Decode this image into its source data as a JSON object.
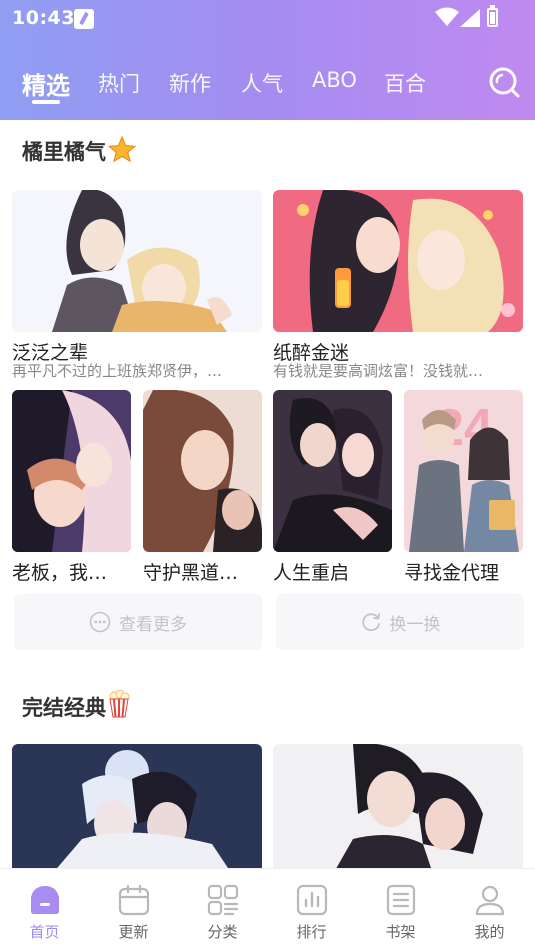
{
  "status_bar": {
    "time": "10:43"
  },
  "tabs": [
    {
      "label": "精选",
      "active": true
    },
    {
      "label": "热门",
      "active": false
    },
    {
      "label": "新作",
      "active": false
    },
    {
      "label": "人气",
      "active": false
    },
    {
      "label": "ABO",
      "active": false
    },
    {
      "label": "百合",
      "active": false
    }
  ],
  "sections": [
    {
      "title": "橘里橘气",
      "emoji": "star-icon",
      "featured": [
        {
          "title": "泛泛之辈",
          "desc": "再平凡不过的上班族郑贤伊，…"
        },
        {
          "title": "纸醉金迷",
          "desc": "有钱就是要高调炫富！没钱就…"
        }
      ],
      "items": [
        {
          "title": "老板，我…"
        },
        {
          "title": "守护黑道…"
        },
        {
          "title": "人生重启"
        },
        {
          "title": "寻找金代理"
        }
      ],
      "more_label": "查看更多",
      "refresh_label": "换一换"
    },
    {
      "title": "完结经典",
      "emoji": "popcorn-icon"
    }
  ],
  "bottom_nav": [
    {
      "label": "首页",
      "icon": "home-icon",
      "active": true
    },
    {
      "label": "更新",
      "icon": "calendar-icon",
      "active": false
    },
    {
      "label": "分类",
      "icon": "category-icon",
      "active": false
    },
    {
      "label": "排行",
      "icon": "ranking-icon",
      "active": false
    },
    {
      "label": "书架",
      "icon": "bookshelf-icon",
      "active": false
    },
    {
      "label": "我的",
      "icon": "profile-icon",
      "active": false
    }
  ],
  "colors": {
    "accent": "#9f8bf0",
    "header_gradient_start": "#8f9ef2",
    "header_gradient_end": "#c08af0"
  }
}
